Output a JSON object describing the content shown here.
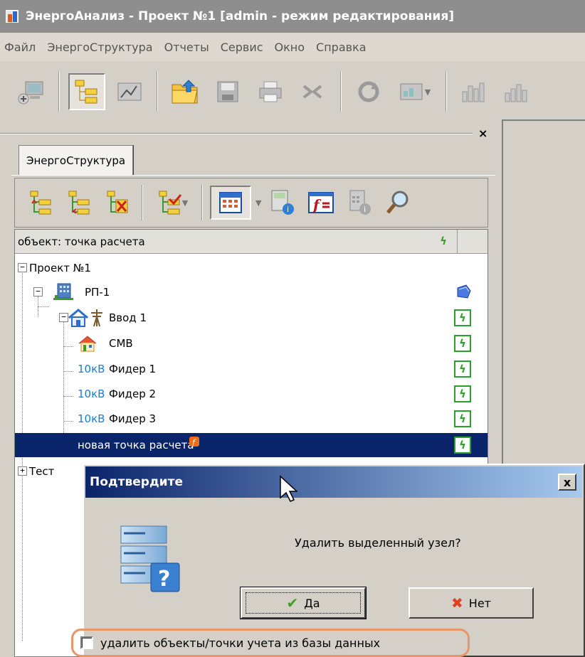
{
  "app": {
    "title": "ЭнергоАнализ - Проект №1 [admin - режим редактирования]"
  },
  "menu": [
    "Файл",
    "ЭнергоСтруктура",
    "Отчеты",
    "Сервис",
    "Окно",
    "Справка"
  ],
  "panel": {
    "tab_label": "ЭнергоСтруктура",
    "close_glyph": "×"
  },
  "tree": {
    "header": "объект: точка расчета",
    "nodes": [
      {
        "label": "Проект №1",
        "prefix": ""
      },
      {
        "label": "РП-1",
        "prefix": ""
      },
      {
        "label": "Ввод 1",
        "prefix": ""
      },
      {
        "label": "СМВ",
        "prefix": ""
      },
      {
        "label": "Фидер 1",
        "prefix": "10кВ"
      },
      {
        "label": "Фидер 2",
        "prefix": "10кВ"
      },
      {
        "label": "Фидер 3",
        "prefix": "10кВ"
      },
      {
        "label": "новая точка расчета",
        "prefix": ""
      },
      {
        "label": "Тест",
        "prefix": ""
      }
    ]
  },
  "dialog": {
    "title": "Подтвердите",
    "close_glyph": "x",
    "message": "Удалить выделенный узел?",
    "yes_label": "Да",
    "no_label": "Нет",
    "checkbox_label": "удалить объекты/точки учета из базы данных",
    "checkbox_checked": false
  },
  "colors": {
    "selection": "#0a246a",
    "voltage_text": "#1a7de0",
    "checkbox_highlight": "#e8956a",
    "status_icon": "#2ca02c"
  }
}
